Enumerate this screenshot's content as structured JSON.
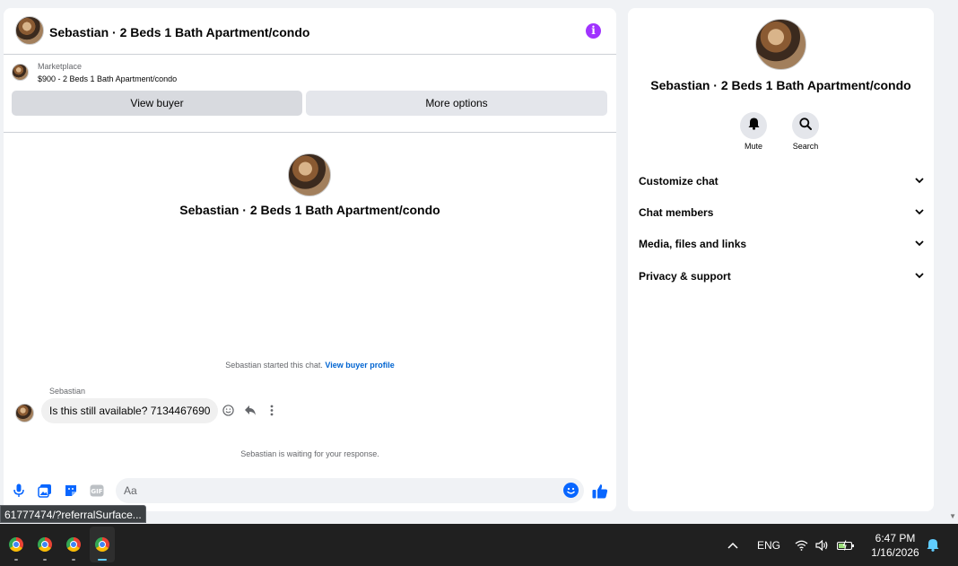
{
  "chat": {
    "header_title": "Sebastian · 2 Beds 1 Bath Apartment/condo",
    "info_icon": "info-icon",
    "marketplace_label": "Marketplace",
    "listing": "$900 - 2 Beds 1 Bath Apartment/condo",
    "view_buyer": "View buyer",
    "more_options": "More options",
    "profile_name": "Sebastian · 2 Beds 1 Bath Apartment/condo",
    "started_text": "Sebastian started this chat.",
    "started_link": "View buyer profile",
    "sender_name": "Sebastian",
    "message": "Is this still available? 7134467690",
    "waiting_text": "Sebastian is waiting for your response.",
    "composer_placeholder": "Aa"
  },
  "info": {
    "name": "Sebastian · 2 Beds 1 Bath Apartment/condo",
    "mute_label": "Mute",
    "search_label": "Search",
    "sections": [
      "Customize chat",
      "Chat members",
      "Media, files and links",
      "Privacy & support"
    ]
  },
  "status_tip": "61777474/?referralSurface...",
  "taskbar": {
    "language": "ENG",
    "time": "6:47 PM",
    "date": "1/16/2026"
  },
  "colors": {
    "accent_blue": "#0866ff",
    "info_purple": "#a033ff",
    "link_blue": "#0064d1"
  }
}
